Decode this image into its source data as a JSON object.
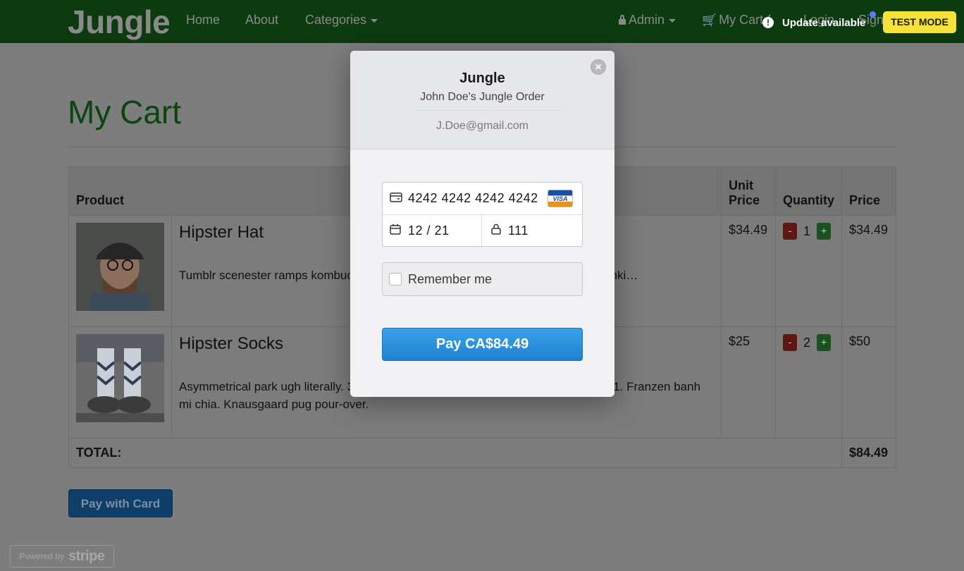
{
  "navbar": {
    "brand": "Jungle",
    "links": {
      "home": "Home",
      "about": "About",
      "categories": "Categories"
    },
    "admin": "Admin",
    "my_cart": "My Cart (",
    "login": "Login",
    "signup": "Sign"
  },
  "overlay": {
    "update_text": "Update available",
    "update_icon": "!",
    "test_mode": "TEST MODE"
  },
  "page": {
    "title": "My Cart"
  },
  "table": {
    "headers": {
      "product": "Product",
      "unit_price": "Unit Price",
      "quantity": "Quantity",
      "price": "Price"
    },
    "rows": [
      {
        "name": "Hipster Hat",
        "description": "Tumblr scenester ramps kombucha … dermy ennui brunch. Swag yolo occupy drinki…",
        "unit_price": "$34.49",
        "quantity": "1",
        "price": "$34.49"
      },
      {
        "name": "Hipster Socks",
        "description": "Asymmetrical park ugh literally. 3 wolf moon polaroid tumblr. Seitan fingerstache +1. Franzen banh mi chia. Knausgaard pug pour-over.",
        "unit_price": "$25",
        "quantity": "2",
        "price": "$50"
      }
    ],
    "qty_minus": "-",
    "qty_plus": "+",
    "total_label": "TOTAL:",
    "total_value": "$84.49"
  },
  "pay_with_card": "Pay with Card",
  "powered_by": {
    "prefix": "Powered by",
    "brand": "stripe"
  },
  "modal": {
    "title": "Jungle",
    "subtitle": "John Doe's Jungle Order",
    "email": "J.Doe@gmail.com",
    "close": "×",
    "card_number": "4242 4242 4242 4242",
    "card_brand": "VISA",
    "expiry": "12 / 21",
    "cvc": "111",
    "remember_me": "Remember me",
    "pay_button": "Pay CA$84.49"
  }
}
